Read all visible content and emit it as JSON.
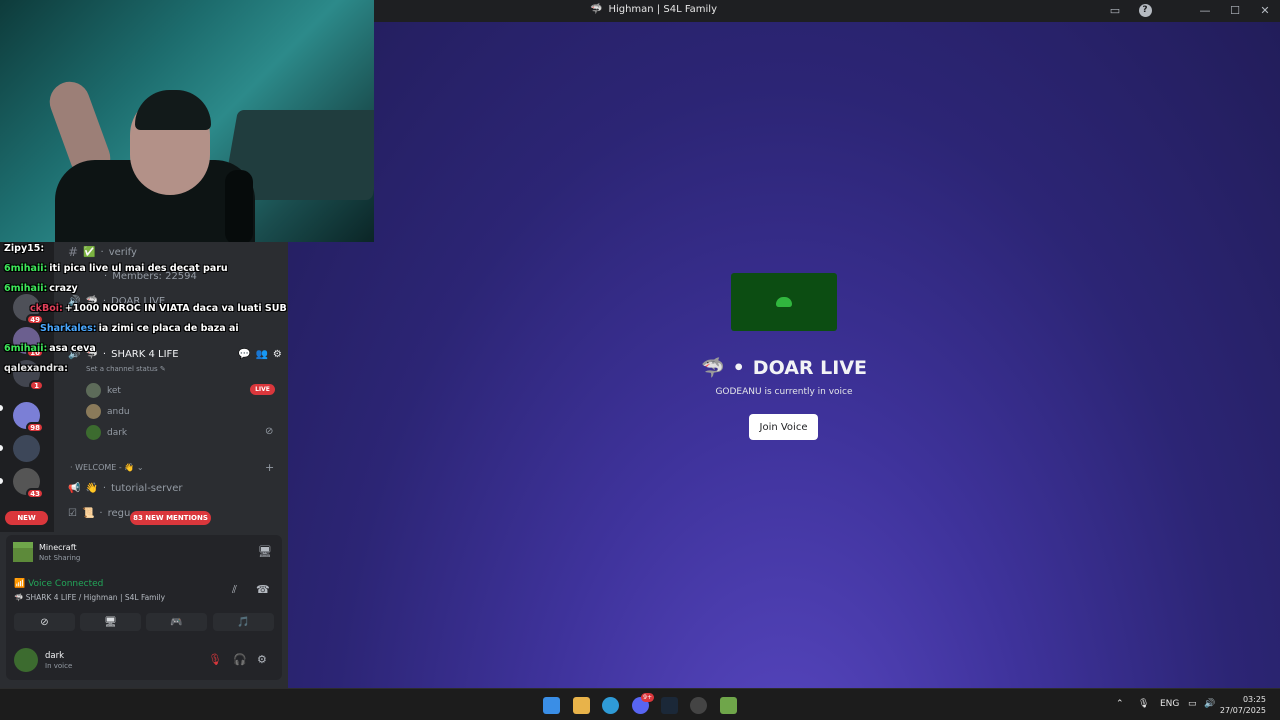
{
  "window": {
    "title": "Highman | S4L Family"
  },
  "main": {
    "channel_name": "DOAR LIVE",
    "status_text": "GODEANU is currently in voice",
    "join_label": "Join Voice"
  },
  "servers": {
    "badges": [
      "49",
      "10",
      "1",
      "98",
      "43"
    ],
    "new_label": "NEW"
  },
  "channels": {
    "verify": "verify",
    "members": "Members: 22594",
    "doar_live": "DOAR LIVE",
    "shark": "SHARK 4 LIFE",
    "set_status": "Set a channel status",
    "voice_users": [
      "ket",
      "andu",
      "dark"
    ],
    "live_badge": "LIVE",
    "category": "WELCOME - 👋",
    "tutorial": "tutorial-server",
    "reguli": "regu",
    "mentions": "83 NEW MENTIONS"
  },
  "activity": {
    "name": "Minecraft",
    "status": "Not Sharing"
  },
  "voice": {
    "title": "Voice Connected",
    "location": "SHARK 4 LIFE / Highman | S4L Family"
  },
  "user": {
    "name": "dark",
    "status": "In voice"
  },
  "chat": [
    {
      "user": "Zipy15:",
      "text": "",
      "color": "#ffffff"
    },
    {
      "user": "6mihaii:",
      "text": "iti pica live ul mai des decat paru",
      "color": "#3ee85a"
    },
    {
      "user": "6mihaii:",
      "text": "crazy",
      "color": "#3ee85a"
    },
    {
      "user": "ckBoi:",
      "text": "+1000 NOROC IN VIATA daca va luati SUB",
      "color": "#e0405a"
    },
    {
      "user": "Sharkales:",
      "text": "ia zimi ce placa de baza ai",
      "color": "#4aa8ff"
    },
    {
      "user": "6mihaii:",
      "text": "asa ceva",
      "color": "#3ee85a"
    },
    {
      "user": "qalexandra:",
      "text": "",
      "color": "#e6e6e6"
    }
  ],
  "taskbar": {
    "discord_badge": "9+",
    "lang": "ENG",
    "time": "03:25",
    "date": "27/07/2025"
  }
}
